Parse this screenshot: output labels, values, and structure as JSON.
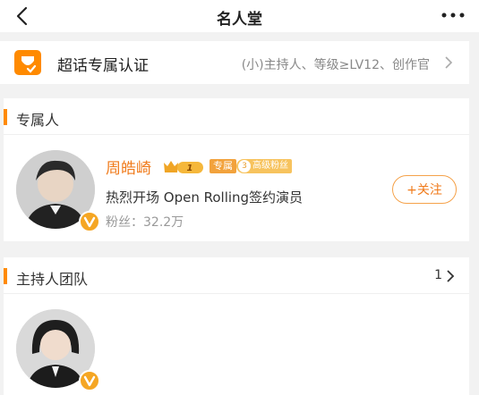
{
  "header": {
    "title": "名人堂"
  },
  "certification": {
    "title": "超话专属认证",
    "description": "(小)主持人、等级≥LV12、创作官"
  },
  "exclusive_section": {
    "title": "专属人",
    "person": {
      "name": "周皓崎",
      "level": "1",
      "tag_exclusive": "专属",
      "fan_tag_level": "3",
      "fan_tag": "高级粉丝",
      "description": "热烈开场 Open Rolling签约演员",
      "fans": "粉丝：32.2万",
      "follow_label": "+关注"
    }
  },
  "host_section": {
    "title": "主持人团队",
    "count": "1"
  },
  "colors": {
    "accent": "#ff8a00",
    "name": "#f07a1a"
  }
}
